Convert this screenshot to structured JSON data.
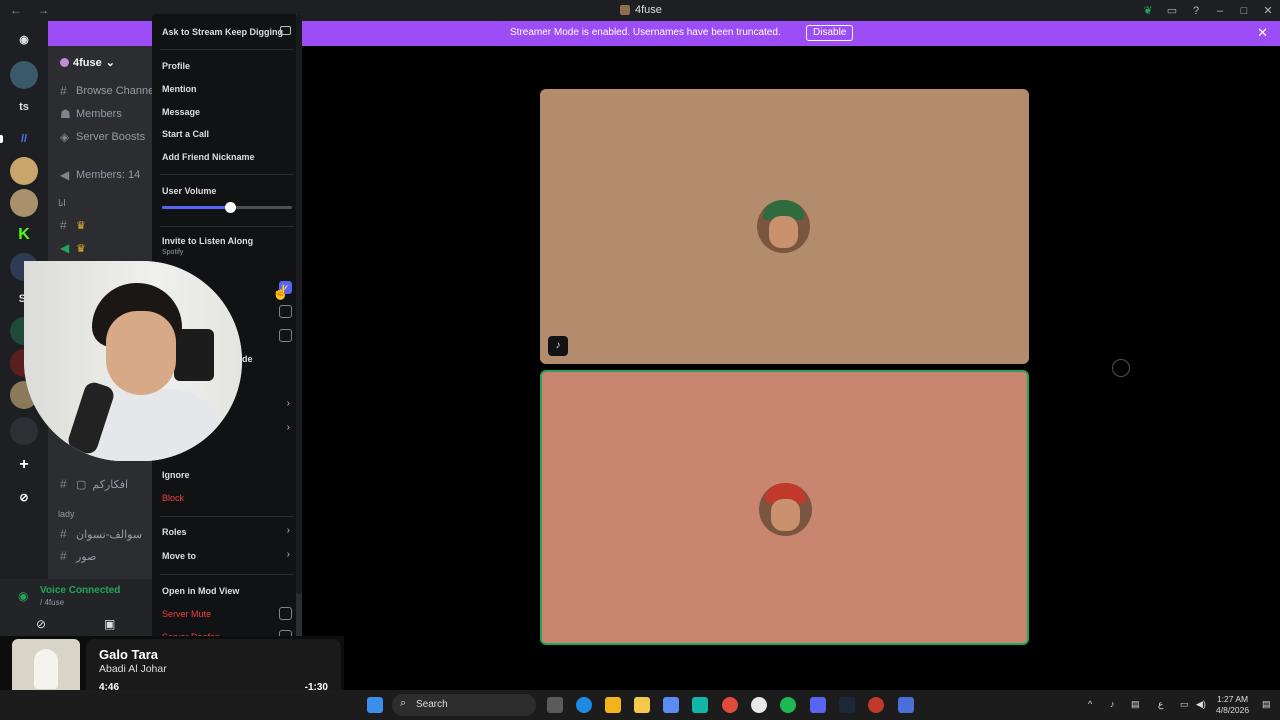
{
  "window": {
    "title": "4fuse",
    "back_icon": "arrow-left-icon",
    "forward_icon": "arrow-right-icon"
  },
  "banner": {
    "message": "Streamer Mode is enabled. Usernames have been truncated.",
    "button": "Disable"
  },
  "server_rail": {
    "items": [
      "ts",
      "SI"
    ]
  },
  "sidebar": {
    "server_name": "4fuse",
    "items": [
      {
        "icon": "#",
        "label": "Browse Channels"
      },
      {
        "icon": "person-icon",
        "label": "Members"
      },
      {
        "icon": "boost-icon",
        "label": "Server Boosts"
      },
      {
        "icon": "speaker-icon",
        "label": "Members: 14"
      }
    ],
    "channels_bottom": [
      {
        "icon": "#",
        "label": "افكاركم"
      },
      {
        "icon": "#",
        "label": "سوالف-نسوان"
      },
      {
        "icon": "#",
        "label": "صور"
      }
    ],
    "categories": [
      "انا",
      "lady"
    ]
  },
  "voice": {
    "status": "Voice Connected",
    "server": "/ 4fuse"
  },
  "context_menu": {
    "items": {
      "ask_stream": "Ask to Stream Keep Digging",
      "profile": "Profile",
      "mention": "Mention",
      "message": "Message",
      "start_call": "Start a Call",
      "add_nickname": "Add Friend Nickname",
      "user_volume": "User Volume",
      "invite_listen": "Invite to Listen Along",
      "invite_sub": "Spotify",
      "partial": "de",
      "ignore": "Ignore",
      "block": "Block",
      "roles": "Roles",
      "move_to": "Move to",
      "mod_view": "Open in Mod View",
      "server_mute": "Server Mute",
      "server_deafen": "Server Deafen"
    },
    "user_volume_level": 0.52
  },
  "music": {
    "title": "Galo Tara",
    "artist": "Abadi Al Johar",
    "elapsed": "4:46",
    "remaining": "-1:30",
    "progress": 0.76
  },
  "taskbar": {
    "search_placeholder": "Search",
    "time": "1:27 AM",
    "date": "4/8/2026",
    "lang": "ع"
  },
  "colors": {
    "banner": "#9d4df5",
    "accent": "#5865f2",
    "danger": "#f23f43",
    "connected": "#23a55a"
  }
}
